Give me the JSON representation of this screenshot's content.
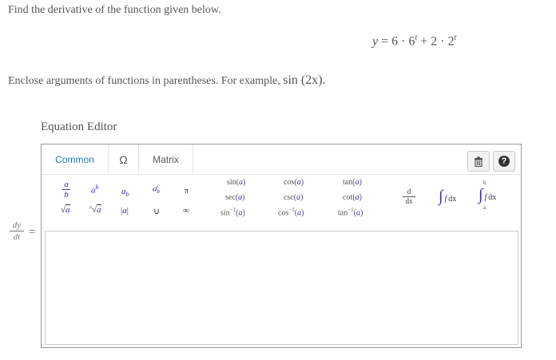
{
  "prompt": "Find the derivative of the function given below.",
  "equation": {
    "lhs": "y",
    "eq": "=",
    "c1": "6",
    "dot1": "·",
    "b1": "6",
    "e1": "t",
    "plus": "+",
    "c2": "2",
    "dot2": "·",
    "b2": "2",
    "e2": "t"
  },
  "hint": {
    "text": "Enclose arguments of functions in parentheses. For example,",
    "example": "sin (2x)."
  },
  "editor": {
    "title": "Equation Editor",
    "tabs": {
      "common": "Common",
      "symbols": "Ω",
      "matrix": "Matrix"
    },
    "tools": {
      "trash_icon": "trash-icon",
      "help_icon": "help-icon",
      "help_glyph": "?"
    },
    "palette": {
      "frac_num": "a",
      "frac_den": "b",
      "pow_base": "a",
      "pow_exp": "b",
      "sub_base": "a",
      "sub_sub": "b",
      "subsup_base": "a",
      "subsup_sup": "c",
      "subsup_sub": "b",
      "pi": "π",
      "sqrt_rad": "√",
      "sqrt_arg": "a",
      "nroot_rad": "√",
      "nroot_arg": "a",
      "nroot_index": "n",
      "abs_open": "|",
      "abs_arg": "a",
      "abs_close": "|",
      "union": "∪",
      "infinity": "∞",
      "sin": "sin",
      "cos": "cos",
      "tan": "tan",
      "sec": "sec",
      "csc": "csc",
      "cot": "cot",
      "asin": "sin",
      "acos": "cos",
      "atan": "tan",
      "inv_exp": "−1",
      "arg": "a",
      "deriv_d": "d",
      "deriv_dx": "dx",
      "int_sign": "∫",
      "int_body": "f",
      "int_dx": "dx",
      "defint_sign": "∫",
      "defint_upper": "b",
      "defint_lower": "a",
      "defint_body": "f",
      "defint_dx": "dx"
    }
  },
  "answer": {
    "lhs_num": "dy",
    "lhs_den": "dt",
    "eq": "=",
    "value": ""
  },
  "colors": {
    "accent": "#1a7cc6",
    "variable": "#3a2fb3",
    "text": "#555555",
    "border": "#999999"
  }
}
